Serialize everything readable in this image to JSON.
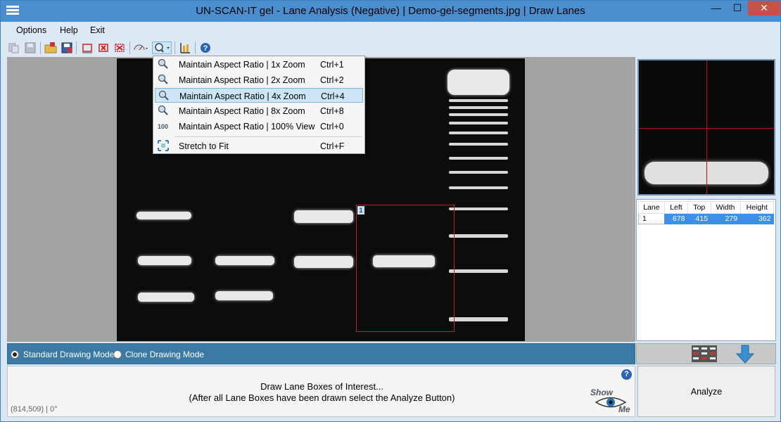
{
  "window": {
    "title": "UN-SCAN-IT gel - Lane Analysis (Negative) | Demo-gel-segments.jpg | Draw Lanes",
    "minimize": "—",
    "maximize": "☐",
    "close": "✕"
  },
  "menu": {
    "options": "Options",
    "help": "Help",
    "exit": "Exit"
  },
  "toolbar": {
    "icons": [
      "copy-icon",
      "save-disabled-icon",
      "open-folder-icon",
      "save-icon",
      "delete-lane-icon",
      "delete-all-icon",
      "clear-icon",
      "view-icon",
      "zoom-icon",
      "align-icon",
      "help-icon"
    ]
  },
  "zoom_menu": {
    "items": [
      {
        "label": "Maintain Aspect Ratio  |  1x Zoom",
        "shortcut": "Ctrl+1",
        "icon": "zoom-1x-icon"
      },
      {
        "label": "Maintain Aspect Ratio  |  2x Zoom",
        "shortcut": "Ctrl+2",
        "icon": "zoom-2x-icon"
      },
      {
        "label": "Maintain Aspect Ratio  |  4x Zoom",
        "shortcut": "Ctrl+4",
        "icon": "zoom-4x-icon",
        "selected": true
      },
      {
        "label": "Maintain Aspect Ratio  |  8x Zoom",
        "shortcut": "Ctrl+8",
        "icon": "zoom-8x-icon"
      },
      {
        "label": "Maintain Aspect Ratio  |  100% View",
        "shortcut": "Ctrl+0",
        "icon": "zoom-100-icon"
      },
      {
        "label": "Stretch to Fit",
        "shortcut": "Ctrl+F",
        "icon": "stretch-icon"
      }
    ]
  },
  "lane_box": {
    "number": "1"
  },
  "lanes_table": {
    "headers": [
      "Lane",
      "Left",
      "Top",
      "Width",
      "Height"
    ],
    "rows": [
      {
        "lane": "1",
        "left": "678",
        "top": "415",
        "width": "279",
        "height": "362"
      }
    ]
  },
  "modes": {
    "standard": "Standard Drawing Mode",
    "clone": "Clone Drawing Mode",
    "selected": "standard"
  },
  "instructions": {
    "line1": "Draw Lane Boxes of Interest...",
    "line2": "(After all Lane Boxes have been drawn select the Analyze Button)",
    "coords": "(814,509)  |  0°",
    "help": "?",
    "show": "Show",
    "me": "Me"
  },
  "analyze_button": {
    "label": "Analyze"
  },
  "colors": {
    "accent": "#3d8fe8",
    "titlebar": "#4a8ed0",
    "lane_box": "#c02020",
    "mode_bar": "#3a7aa4"
  }
}
